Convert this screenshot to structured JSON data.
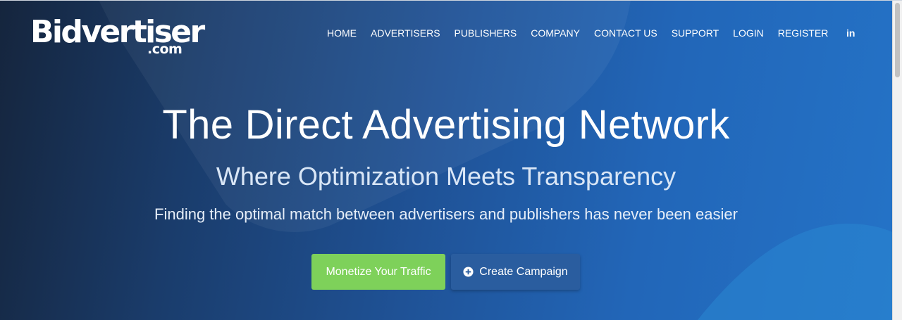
{
  "brand": {
    "name": "Bidvertiser",
    "domain_suffix": ".com"
  },
  "nav": {
    "items": [
      {
        "label": "HOME"
      },
      {
        "label": "ADVERTISERS"
      },
      {
        "label": "PUBLISHERS"
      },
      {
        "label": "COMPANY"
      },
      {
        "label": "CONTACT US"
      },
      {
        "label": "SUPPORT"
      },
      {
        "label": "LOGIN"
      },
      {
        "label": "REGISTER"
      }
    ],
    "social_label": "in",
    "social_icon": "linkedin-icon"
  },
  "hero": {
    "headline": "The Direct Advertising Network",
    "subheadline": "Where Optimization Meets Transparency",
    "tagline": "Finding the optimal match between advertisers and publishers has never been easier"
  },
  "buttons": {
    "monetize_label": "Monetize Your Traffic",
    "campaign_label": "Create Campaign",
    "campaign_icon": "plus-circle-icon"
  },
  "colors": {
    "hero_gradient_start": "#15253d",
    "hero_gradient_end": "#2473c7",
    "monetize_button": "#7ed15a",
    "campaign_button": "#2a5d9f",
    "text": "#ffffff"
  }
}
